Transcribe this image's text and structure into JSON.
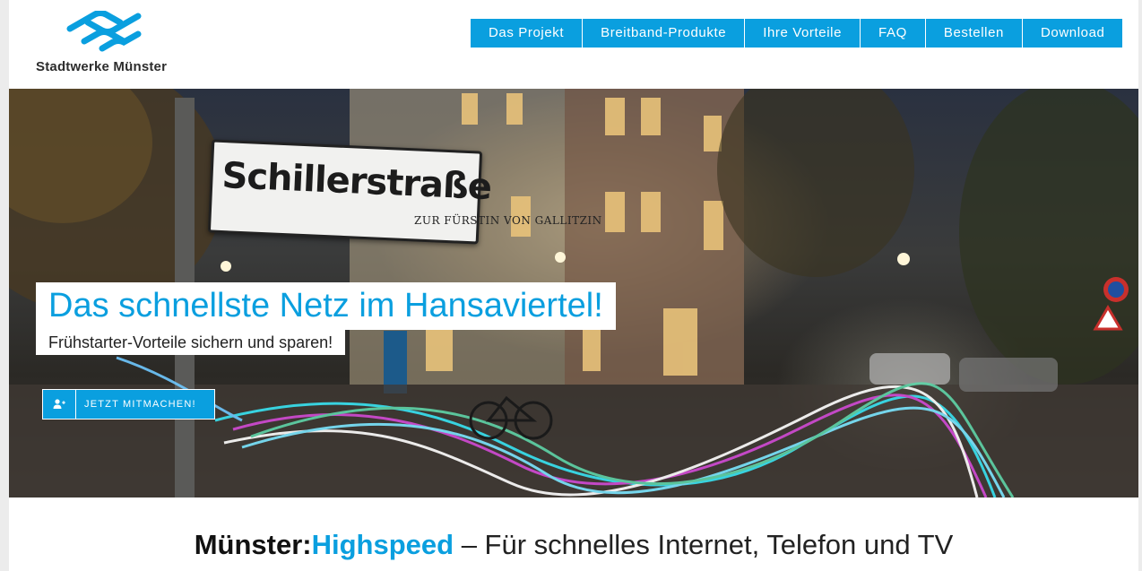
{
  "colors": {
    "accent": "#0a9fdf",
    "nav_text": "#ffffff",
    "heading_dark": "#111111"
  },
  "header": {
    "logo": {
      "icon": "stadtwerke-wave-logo",
      "text": "Stadtwerke Münster"
    },
    "nav": [
      {
        "label": "Das Projekt"
      },
      {
        "label": "Breitband-Produkte"
      },
      {
        "label": "Ihre Vorteile"
      },
      {
        "label": "FAQ"
      },
      {
        "label": "Bestellen"
      },
      {
        "label": "Download"
      }
    ]
  },
  "hero": {
    "street_sign": "Schillerstraße",
    "building_sign": "ZUR FÜRSTIN VON GALLITZIN",
    "headline": "Das schnellste Netz im Hansaviertel!",
    "subline": "Frühstarter-Vorteile sichern und sparen!",
    "cta": {
      "icon": "user-plus-icon",
      "label": "JETZT MITMACHEN!"
    }
  },
  "tagline": {
    "brand": "Münster:",
    "accent": "Highspeed",
    "rest": " – Für schnelles Internet, Telefon und TV"
  }
}
